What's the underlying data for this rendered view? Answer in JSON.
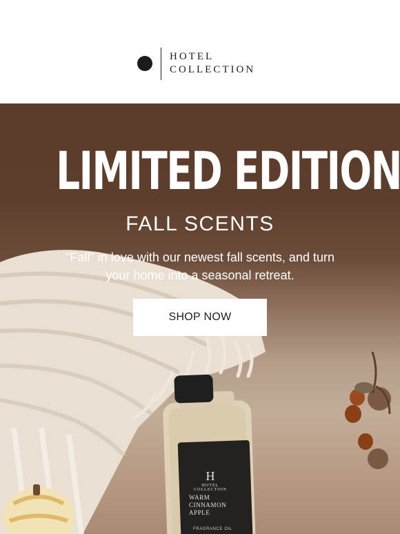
{
  "brand": {
    "line1": "HOTEL",
    "line2": "COLLECTION"
  },
  "hero": {
    "title": "LIMITED EDITION",
    "subtitle": "FALL SCENTS",
    "description": "\"Fall\" in love with our newest fall scents, and turn your home into a seasonal retreat.",
    "cta_label": "SHOP NOW"
  },
  "bottle": {
    "monogram": "H",
    "brand": "HOTEL COLLECTION",
    "name": "WARM CINNAMON APPLE",
    "type": "FRAGRANCE OIL"
  },
  "colors": {
    "hero_brown": "#5b3c2a",
    "header_bg": "#ffffff",
    "button_bg": "#ffffff",
    "text_dark": "#1c1c1c"
  }
}
